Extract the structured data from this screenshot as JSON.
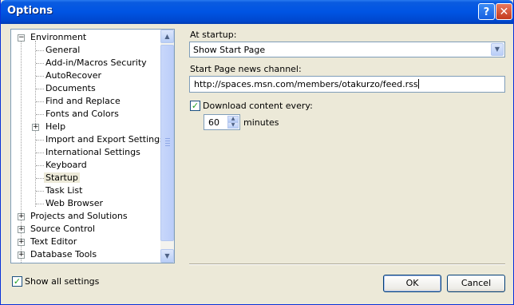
{
  "window": {
    "title": "Options",
    "help_glyph": "?",
    "close_glyph": "✕"
  },
  "tree": {
    "items": [
      {
        "label": "Environment",
        "expander": "−"
      },
      {
        "label": "General"
      },
      {
        "label": "Add-in/Macros Security"
      },
      {
        "label": "AutoRecover"
      },
      {
        "label": "Documents"
      },
      {
        "label": "Find and Replace"
      },
      {
        "label": "Fonts and Colors"
      },
      {
        "label": "Help",
        "expander": "+"
      },
      {
        "label": "Import and Export Settings"
      },
      {
        "label": "International Settings"
      },
      {
        "label": "Keyboard"
      },
      {
        "label": "Startup"
      },
      {
        "label": "Task List"
      },
      {
        "label": "Web Browser"
      },
      {
        "label": "Projects and Solutions",
        "expander": "+"
      },
      {
        "label": "Source Control",
        "expander": "+"
      },
      {
        "label": "Text Editor",
        "expander": "+"
      },
      {
        "label": "Database Tools",
        "expander": "+"
      }
    ],
    "selected": "Startup"
  },
  "startup": {
    "at_startup_label": "At startup:",
    "at_startup_value": "Show Start Page",
    "news_channel_label": "Start Page news channel:",
    "news_channel_value": "http://spaces.msn.com/members/otakurzo/feed.rss",
    "download_label": "Download content every:",
    "download_checked": true,
    "interval_value": "60",
    "interval_unit": "minutes"
  },
  "footer": {
    "show_all_label": "Show all settings",
    "show_all_checked": true,
    "ok_label": "OK",
    "cancel_label": "Cancel"
  },
  "colors": {
    "title_bar": "#0054E3",
    "dialog_bg": "#ECE9D8",
    "check_mark": "#21A121"
  }
}
